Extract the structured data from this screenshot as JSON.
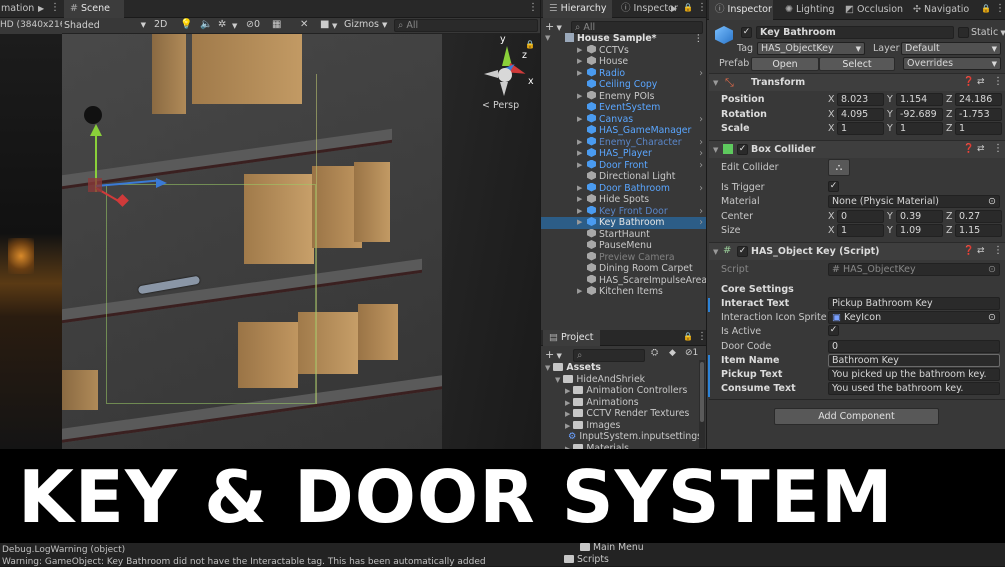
{
  "left_window": {
    "tab": "mation",
    "res": "HD (3840x2160)"
  },
  "scene": {
    "tab": "Scene",
    "shading": "Shaded",
    "mode_2d": "2D",
    "gizmos": "Gizmos",
    "search_placeholder": "All",
    "hidden_count": "0",
    "persp": "< Persp",
    "axes": {
      "x": "x",
      "y": "y",
      "z": "z"
    }
  },
  "hierarchy": {
    "tab": "Hierarchy",
    "tab2": "Inspector",
    "search_placeholder": "All",
    "root": "House Sample*",
    "items": [
      {
        "label": "CCTVs",
        "color": "#c8c8c8",
        "icon": "gray",
        "arrow": true
      },
      {
        "label": "House",
        "color": "#c8c8c8",
        "icon": "gray",
        "arrow": true
      },
      {
        "label": "Radio",
        "color": "#5aa6ff",
        "icon": "blue",
        "arrow": true
      },
      {
        "label": "Ceiling Copy",
        "color": "#5aa6ff",
        "icon": "blue",
        "arrow": false
      },
      {
        "label": "Enemy POIs",
        "color": "#c8c8c8",
        "icon": "gray",
        "arrow": true
      },
      {
        "label": "EventSystem",
        "color": "#5aa6ff",
        "icon": "blue",
        "arrow": false
      },
      {
        "label": "Canvas",
        "color": "#5aa6ff",
        "icon": "blue",
        "arrow": true
      },
      {
        "label": "HAS_GameManager",
        "color": "#5aa6ff",
        "icon": "blue",
        "arrow": false
      },
      {
        "label": "Enemy_Character",
        "color": "#5a86c8",
        "icon": "blue",
        "arrow": true
      },
      {
        "label": "HAS_Player",
        "color": "#5aa6ff",
        "icon": "blue",
        "arrow": true
      },
      {
        "label": "Door Front",
        "color": "#5aa6ff",
        "icon": "blue",
        "arrow": true
      },
      {
        "label": "Directional Light",
        "color": "#c8c8c8",
        "icon": "gray",
        "arrow": false
      },
      {
        "label": "Door Bathroom",
        "color": "#5aa6ff",
        "icon": "blue",
        "arrow": true
      },
      {
        "label": "Hide Spots",
        "color": "#c8c8c8",
        "icon": "gray",
        "arrow": true
      },
      {
        "label": "Key Front Door",
        "color": "#5a86c8",
        "icon": "blue",
        "arrow": true
      },
      {
        "label": "Key Bathroom",
        "color": "#e6e6e6",
        "icon": "blue",
        "arrow": true,
        "selected": true
      },
      {
        "label": "StartHaunt",
        "color": "#c8c8c8",
        "icon": "gray",
        "arrow": false
      },
      {
        "label": "PauseMenu",
        "color": "#c8c8c8",
        "icon": "gray",
        "arrow": false
      },
      {
        "label": "Preview Camera",
        "color": "#808080",
        "icon": "gray",
        "arrow": false
      },
      {
        "label": "Dining Room Carpet",
        "color": "#c8c8c8",
        "icon": "gray",
        "arrow": false
      },
      {
        "label": "HAS_ScareImpulseArea",
        "color": "#c8c8c8",
        "icon": "gray",
        "arrow": false
      },
      {
        "label": "Kitchen Items",
        "color": "#c8c8c8",
        "icon": "gray",
        "arrow": true
      }
    ]
  },
  "project": {
    "tab": "Project",
    "count": "1",
    "items": [
      {
        "label": "Assets",
        "bold": true
      },
      {
        "label": "HideAndShriek"
      },
      {
        "label": "Animation Controllers"
      },
      {
        "label": "Animations"
      },
      {
        "label": "CCTV Render Textures"
      },
      {
        "label": "Images"
      },
      {
        "label": "InputSystem.inputsettings"
      },
      {
        "label": "Materials"
      }
    ],
    "lower_items": [
      {
        "label": "Main Menu"
      },
      {
        "label": "Scripts"
      }
    ]
  },
  "inspector_tabs": [
    "Inspector",
    "Lighting",
    "Occlusion",
    "Navigatio"
  ],
  "inspector": {
    "name": "Key Bathroom",
    "static": "Static",
    "tag_label": "Tag",
    "tag": "HAS_ObjectKey",
    "layer_label": "Layer",
    "layer": "Default",
    "prefab_label": "Prefab",
    "prefab_open": "Open",
    "prefab_select": "Select",
    "prefab_overrides": "Overrides",
    "transform": {
      "title": "Transform",
      "rows": [
        {
          "label": "Position",
          "x": "8.023",
          "y": "1.154",
          "z": "24.186"
        },
        {
          "label": "Rotation",
          "x": "4.095",
          "y": "-92.689",
          "z": "-1.753"
        },
        {
          "label": "Scale",
          "x": "1",
          "y": "1",
          "z": "1"
        }
      ]
    },
    "box_collider": {
      "title": "Box Collider",
      "edit_collider": "Edit Collider",
      "is_trigger": "Is Trigger",
      "material_label": "Material",
      "material": "None (Physic Material)",
      "center_label": "Center",
      "center": {
        "x": "0",
        "y": "0.39",
        "z": "0.27"
      },
      "size_label": "Size",
      "size": {
        "x": "1",
        "y": "1.09",
        "z": "1.15"
      }
    },
    "script_comp": {
      "title": "HAS_Object Key (Script)",
      "script_label": "Script",
      "script": "HAS_ObjectKey",
      "core_settings": "Core Settings",
      "interact_text_label": "Interact Text",
      "interact_text": "Pickup Bathroom Key",
      "icon_sprite_label": "Interaction Icon Sprite",
      "icon_sprite": "KeyIcon",
      "is_active_label": "Is Active",
      "door_code_label": "Door Code",
      "door_code": "0",
      "item_name_label": "Item Name",
      "item_name": "Bathroom Key",
      "pickup_text_label": "Pickup Text",
      "pickup_text": "You picked up the bathroom key.",
      "consume_text_label": "Consume Text",
      "consume_text": "You used the bathroom key."
    },
    "add_component": "Add Component"
  },
  "banner": {
    "title": "KEY & DOOR SYSTEM"
  },
  "console": {
    "line1": "Debug.LogWarning (object)",
    "line2": "Warning: GameObject: Key Bathroom did not have the Interactable tag. This has been automatically added"
  },
  "colors": {
    "accent": "#2c5d87",
    "blue_text": "#5aa6ff",
    "banner_bg": "#000000"
  }
}
